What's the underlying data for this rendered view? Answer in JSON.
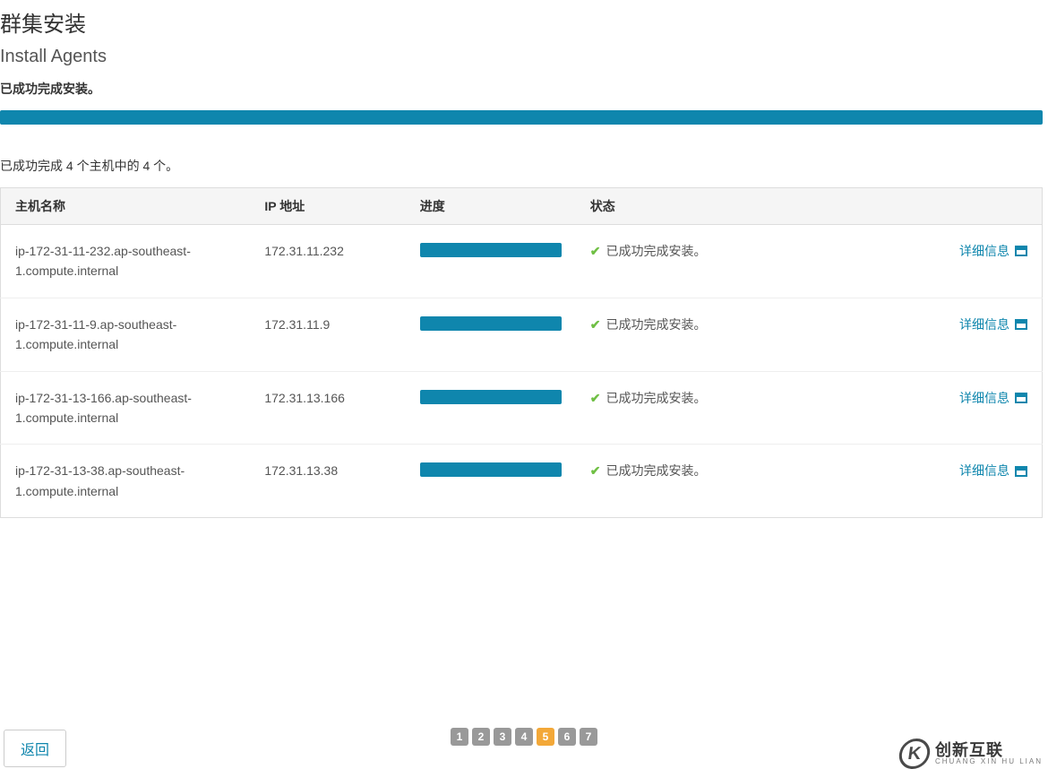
{
  "header": {
    "title": "群集安装",
    "subtitle": "Install Agents",
    "success_message": "已成功完成安装。"
  },
  "summary": "已成功完成 4 个主机中的 4 个。",
  "table": {
    "columns": {
      "host": "主机名称",
      "ip": "IP 地址",
      "progress": "进度",
      "status": "状态"
    },
    "rows": [
      {
        "host": "ip-172-31-11-232.ap-southeast-1.compute.internal",
        "ip": "172.31.11.232",
        "status": "已成功完成安装。",
        "detail_label": "详细信息"
      },
      {
        "host": "ip-172-31-11-9.ap-southeast-1.compute.internal",
        "ip": "172.31.11.9",
        "status": "已成功完成安装。",
        "detail_label": "详细信息"
      },
      {
        "host": "ip-172-31-13-166.ap-southeast-1.compute.internal",
        "ip": "172.31.13.166",
        "status": "已成功完成安装。",
        "detail_label": "详细信息"
      },
      {
        "host": "ip-172-31-13-38.ap-southeast-1.compute.internal",
        "ip": "172.31.13.38",
        "status": "已成功完成安装。",
        "detail_label": "详细信息"
      }
    ]
  },
  "footer": {
    "back_label": "返回",
    "pager": {
      "pages": [
        "1",
        "2",
        "3",
        "4",
        "5",
        "6",
        "7"
      ],
      "active": "5"
    },
    "brand": {
      "cn": "创新互联",
      "en": "CHUANG XIN HU LIAN",
      "mark": "K"
    }
  },
  "colors": {
    "accent": "#0f86ad",
    "success": "#6fbf44",
    "page_active": "#f3a838",
    "page_inactive": "#999999"
  }
}
